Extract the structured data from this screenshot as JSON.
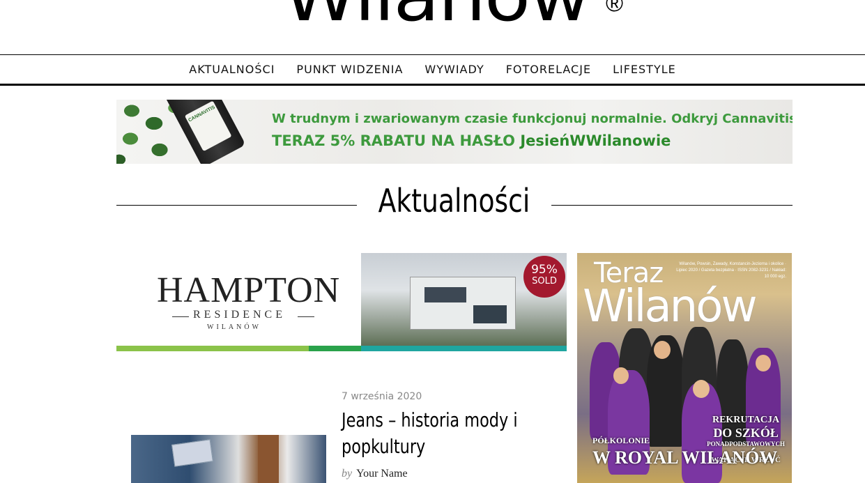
{
  "header": {
    "logo_text": "Wilanów",
    "logo_reg": "®"
  },
  "nav": {
    "items": [
      {
        "label": "AKTUALNOŚCI"
      },
      {
        "label": "PUNKT WIDZENIA"
      },
      {
        "label": "WYWIADY"
      },
      {
        "label": "FOTORELACJE"
      },
      {
        "label": "LIFESTYLE"
      }
    ]
  },
  "banner": {
    "line1": "W trudnym i zwariowanym czasie funkcjonuj normalnie. Odkryj Cannavitis.",
    "line2_prefix": "TERAZ 5% RABATU NA HASŁO ",
    "line2_code": "JesieńWWilanowie",
    "bottle_label": "CANNAVITIS",
    "accent_color": "#3d9a3d"
  },
  "section": {
    "title": "Aktualności"
  },
  "hampton_ad": {
    "name": "HAMPTON",
    "residence": "RESIDENCE",
    "location": "WILANÓW",
    "badge_percent": "95%",
    "badge_word": "SOLD",
    "badge_color": "#a3192e"
  },
  "article": {
    "date": "7 września 2020",
    "title": "Jeans – historia mody i popkultury",
    "by": "by",
    "author": "Your Name"
  },
  "magazine": {
    "teraz": "Teraz",
    "title": "Wilanów",
    "meta": "Wilanów, Powsin, Zawady, Konstancin-Jeziorna i okolice · Lipiec 2020 / Gazeta bezpłatna · ISSN 2082-3231 / Nakład: 10 000 egz.",
    "right_a": "REKRUTACJA",
    "right_b": "DO SZKÓŁ",
    "right_c": "PONADPODSTAWOWYCH",
    "right_d": "WAKACJE WRZUĆ",
    "left_a": "PÓŁKOLONIE",
    "left_b": "W ROYAL WILANÓW"
  }
}
